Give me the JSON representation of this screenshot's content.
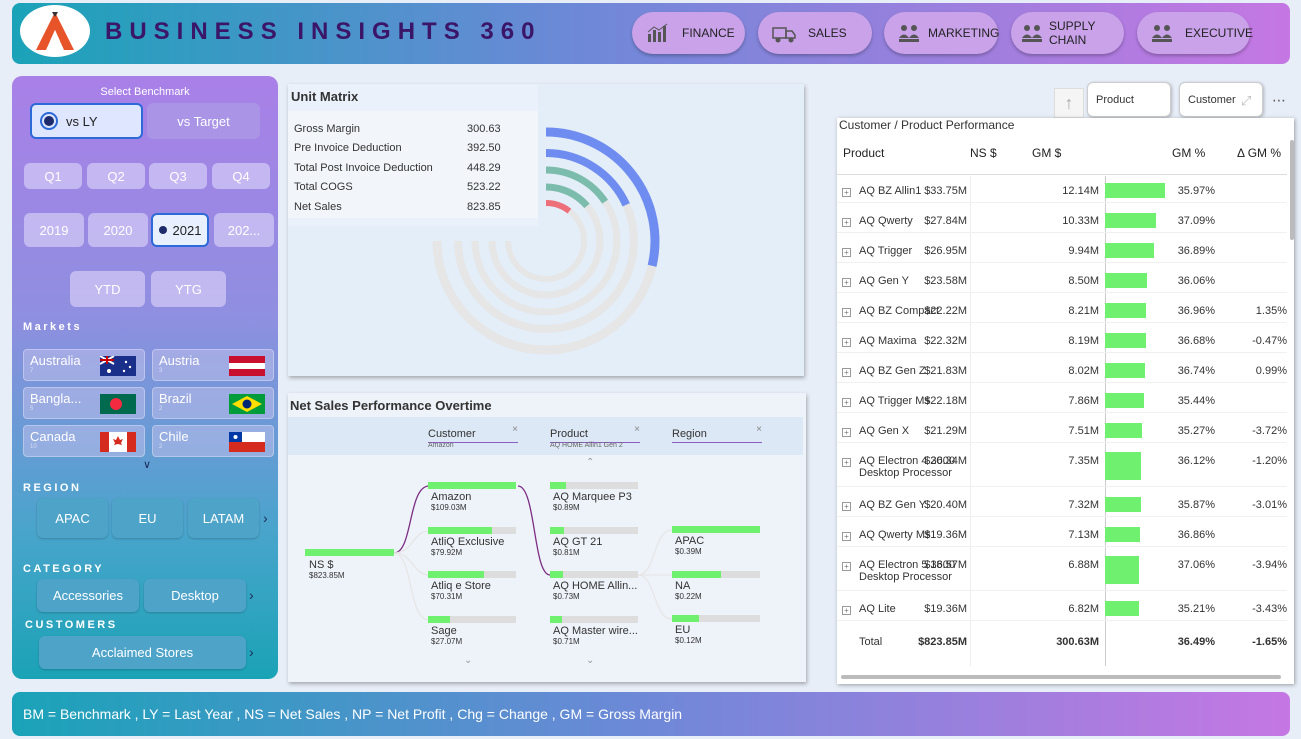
{
  "header": {
    "title": "BUSINESS INSIGHTS 360",
    "nav": [
      {
        "label": "FINANCE",
        "icon": "bar-chart-icon"
      },
      {
        "label": "SALES",
        "icon": "truck-icon"
      },
      {
        "label": "MARKETING",
        "icon": "people-icon"
      },
      {
        "label": "SUPPLY CHAIN",
        "icon": "cart-icon"
      },
      {
        "label": "EXECUTIVE",
        "icon": "people-icon"
      }
    ]
  },
  "sidebar": {
    "benchmark_title": "Select Benchmark",
    "benchmark": [
      "vs LY",
      "vs Target"
    ],
    "quarters": [
      "Q1",
      "Q2",
      "Q3",
      "Q4"
    ],
    "years": [
      "2019",
      "2020",
      "2021",
      "202..."
    ],
    "periods": [
      "YTD",
      "YTG"
    ],
    "markets_title": "Markets",
    "markets": [
      {
        "name": "Australia",
        "n": "7"
      },
      {
        "name": "Austria",
        "n": "3"
      },
      {
        "name": "Bangla...",
        "n": "5"
      },
      {
        "name": "Brazil",
        "n": "2"
      },
      {
        "name": "Canada",
        "n": "10"
      },
      {
        "name": "Chile",
        "n": "2"
      }
    ],
    "region_title": "REGION",
    "regions": [
      "APAC",
      "EU",
      "LATAM"
    ],
    "category_title": "CATEGORY",
    "categories": [
      "Accessories",
      "Desktop"
    ],
    "customers_title": "CUSTOMERS",
    "customers": [
      "Acclaimed Stores"
    ]
  },
  "unit_matrix": {
    "title": "Unit Matrix",
    "rows": [
      {
        "label": "Gross Margin",
        "value": "300.63"
      },
      {
        "label": "Pre Invoice Deduction",
        "value": "392.50"
      },
      {
        "label": "Total Post Invoice Deduction",
        "value": "448.29"
      },
      {
        "label": "Total COGS",
        "value": "523.22"
      },
      {
        "label": "Net Sales",
        "value": "823.85"
      }
    ],
    "colors": {
      "blue": "#6f8df0",
      "teal": "#7cbcad",
      "red": "#ec6f7a",
      "grey": "#e6e6e6"
    }
  },
  "net_sales": {
    "title": "Net Sales Performance Overtime",
    "filters": [
      {
        "label": "Customer",
        "sub": "Amazon"
      },
      {
        "label": "Product",
        "sub": "AQ HOME Allin1 Gen 2"
      },
      {
        "label": "Region",
        "sub": ""
      }
    ],
    "root": {
      "label": "NS $",
      "value": "$823.85M"
    },
    "customers": [
      {
        "label": "Amazon",
        "value": "$109.03M",
        "fill": 1.0
      },
      {
        "label": "AtliQ Exclusive",
        "value": "$79.92M",
        "fill": 0.73
      },
      {
        "label": "Atliq e Store",
        "value": "$70.31M",
        "fill": 0.64
      },
      {
        "label": "Sage",
        "value": "$27.07M",
        "fill": 0.25
      }
    ],
    "products": [
      {
        "label": "AQ Marquee P3",
        "value": "$0.89M",
        "fill": 0.18
      },
      {
        "label": "AQ GT 21",
        "value": "$0.81M",
        "fill": 0.16
      },
      {
        "label": "AQ HOME Allin...",
        "value": "$0.73M",
        "fill": 0.15
      },
      {
        "label": "AQ Master wire...",
        "value": "$0.71M",
        "fill": 0.14
      }
    ],
    "regions": [
      {
        "label": "APAC",
        "value": "$0.39M",
        "fill": 1.0
      },
      {
        "label": "NA",
        "value": "$0.22M",
        "fill": 0.56
      },
      {
        "label": "EU",
        "value": "$0.12M",
        "fill": 0.31
      }
    ]
  },
  "table": {
    "title": "Customer / Product Performance",
    "toggles": [
      "Product",
      "Customer"
    ],
    "columns": [
      "Product",
      "NS $",
      "GM $",
      "GM %",
      "Δ GM %"
    ],
    "rows": [
      {
        "name": "AQ BZ Allin1",
        "ns": "$33.75M",
        "gm": "12.14M",
        "gm_m": 12.14,
        "pct": "35.97%",
        "dgm": ""
      },
      {
        "name": "AQ Qwerty",
        "ns": "$27.84M",
        "gm": "10.33M",
        "gm_m": 10.33,
        "pct": "37.09%",
        "dgm": ""
      },
      {
        "name": "AQ Trigger",
        "ns": "$26.95M",
        "gm": "9.94M",
        "gm_m": 9.94,
        "pct": "36.89%",
        "dgm": ""
      },
      {
        "name": "AQ Gen Y",
        "ns": "$23.58M",
        "gm": "8.50M",
        "gm_m": 8.5,
        "pct": "36.06%",
        "dgm": ""
      },
      {
        "name": "AQ BZ Compact",
        "ns": "$22.22M",
        "gm": "8.21M",
        "gm_m": 8.21,
        "pct": "36.96%",
        "dgm": "1.35%"
      },
      {
        "name": "AQ Maxima",
        "ns": "$22.32M",
        "gm": "8.19M",
        "gm_m": 8.19,
        "pct": "36.68%",
        "dgm": "-0.47%"
      },
      {
        "name": "AQ BZ Gen Z",
        "ns": "$21.83M",
        "gm": "8.02M",
        "gm_m": 8.02,
        "pct": "36.74%",
        "dgm": "0.99%"
      },
      {
        "name": "AQ Trigger Ms",
        "ns": "$22.18M",
        "gm": "7.86M",
        "gm_m": 7.86,
        "pct": "35.44%",
        "dgm": ""
      },
      {
        "name": "AQ Gen X",
        "ns": "$21.29M",
        "gm": "7.51M",
        "gm_m": 7.51,
        "pct": "35.27%",
        "dgm": "-3.72%"
      },
      {
        "name": "AQ Electron 4 3600 Desktop Processor",
        "ns": "$20.34M",
        "gm": "7.35M",
        "gm_m": 7.35,
        "pct": "36.12%",
        "dgm": "-1.20%"
      },
      {
        "name": "AQ BZ Gen Y",
        "ns": "$20.40M",
        "gm": "7.32M",
        "gm_m": 7.32,
        "pct": "35.87%",
        "dgm": "-3.01%"
      },
      {
        "name": "AQ Qwerty Ms",
        "ns": "$19.36M",
        "gm": "7.13M",
        "gm_m": 7.13,
        "pct": "36.86%",
        "dgm": ""
      },
      {
        "name": "AQ Electron 5 3600 Desktop Processor",
        "ns": "$18.57M",
        "gm": "6.88M",
        "gm_m": 6.88,
        "pct": "37.06%",
        "dgm": "-3.94%"
      },
      {
        "name": "AQ Lite",
        "ns": "$19.36M",
        "gm": "6.82M",
        "gm_m": 6.82,
        "pct": "35.21%",
        "dgm": "-3.43%"
      }
    ],
    "total": {
      "name": "Total",
      "ns": "$823.85M",
      "gm": "300.63M",
      "pct": "36.49%",
      "dgm": "-1.65%"
    }
  },
  "footer": {
    "text": "BM = Benchmark , LY = Last Year , NS = Net Sales , NP = Net Profit , Chg = Change , GM = Gross Margin"
  }
}
